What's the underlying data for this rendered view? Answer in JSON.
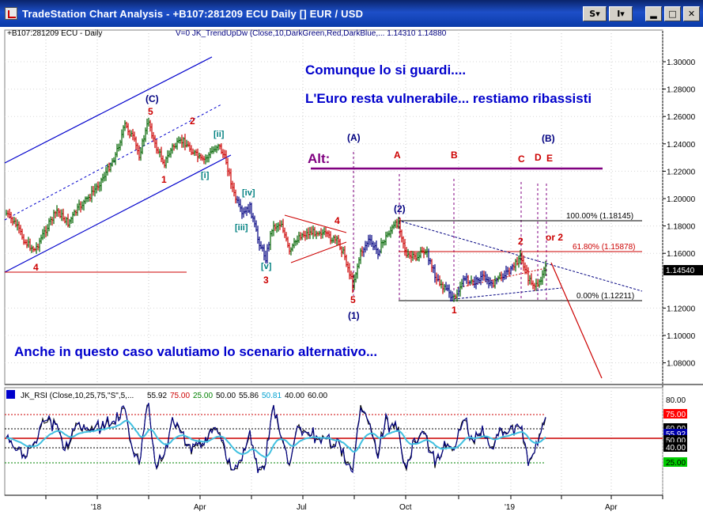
{
  "window": {
    "title": "TradeStation Chart Analysis  - +B107:281209 ECU Daily [] EUR / USD",
    "btn_s": "S",
    "btn_i": "I"
  },
  "colors": {
    "up_bar": "#006400",
    "down_bar": "#cc0000",
    "neutral_bar": "#000080",
    "annotation_blue": "#0000cc",
    "alt_purple": "#800080",
    "fib_red": "#cc0000"
  },
  "price_panel": {
    "symbol_label": "+B107:281209 ECU - Daily",
    "indicator_header": "V=0  JK_TrendUpDw (Close,10,DarkGreen,Red,DarkBlue,...   1.14310  1.14880",
    "current_price": "1.14540",
    "y_ticks": [
      "1.30000",
      "1.28000",
      "1.26000",
      "1.24000",
      "1.22000",
      "1.20000",
      "1.18000",
      "1.16000",
      "1.12000",
      "1.10000",
      "1.08000"
    ],
    "y_tick_values": [
      1.3,
      1.28,
      1.26,
      1.24,
      1.22,
      1.2,
      1.18,
      1.16,
      1.12,
      1.1,
      1.08
    ],
    "text_line1": "Comunque lo si guardi....",
    "text_line2": "L'Euro resta vulnerabile... restiamo ribassisti",
    "text_line3": "Anche in questo caso valutiamo lo scenario alternativo...",
    "alt_label": "Alt:",
    "fib": [
      {
        "label": "100.00% (1.18145)",
        "value": 1.18145
      },
      {
        "label": "61.80% (1.15878)",
        "value": 1.15878
      },
      {
        "label": "0.00% (1.12211)",
        "value": 1.12211
      }
    ],
    "wave_labels": {
      "C_paren": "(C)",
      "five_top": "5",
      "two_top": "2",
      "one_top": "1",
      "ii": "[ii]",
      "i": "[i]",
      "iv": "[iv]",
      "iii": "[iii]",
      "v": "[v]",
      "three": "3",
      "four_left": "4",
      "four_tri": "4",
      "five_low": "5",
      "one_paren": "(1)",
      "A_paren": "(A)",
      "two_paren": "(2)",
      "A": "A",
      "B": "B",
      "C": "C",
      "D": "D",
      "E": "E",
      "B_paren": "(B)",
      "one_low": "1",
      "two_right": "2",
      "or2": "or 2"
    }
  },
  "rsi_panel": {
    "header_name": "JK_RSI (Close,10,25,75,\"S\",5,...",
    "values": [
      {
        "text": "55.92",
        "color": "#000000"
      },
      {
        "text": "75.00",
        "color": "#cc0000"
      },
      {
        "text": "25.00",
        "color": "#008000"
      },
      {
        "text": "50.00",
        "color": "#000000"
      },
      {
        "text": "55.86",
        "color": "#000000"
      },
      {
        "text": "50.81",
        "color": "#00a0d0"
      },
      {
        "text": "40.00",
        "color": "#000000"
      },
      {
        "text": "60.00",
        "color": "#000000"
      }
    ],
    "y_top": "80.00",
    "badges": [
      {
        "text": "75.00",
        "bg": "#ff0000",
        "fg": "#ffffff"
      },
      {
        "text": "60.00",
        "bg": "#000000",
        "fg": "#ffffff"
      },
      {
        "text": "55.92",
        "bg": "#0000aa",
        "fg": "#ffffff"
      },
      {
        "text": "50.00",
        "bg": "#000000",
        "fg": "#ffffff"
      },
      {
        "text": "40.00",
        "bg": "#000000",
        "fg": "#ffffff"
      },
      {
        "text": "25.00",
        "bg": "#00cc00",
        "fg": "#000000"
      }
    ]
  },
  "x_axis": {
    "labels": [
      "'18",
      "Apr",
      "Jul",
      "Oct",
      "'19",
      "Apr"
    ]
  }
}
